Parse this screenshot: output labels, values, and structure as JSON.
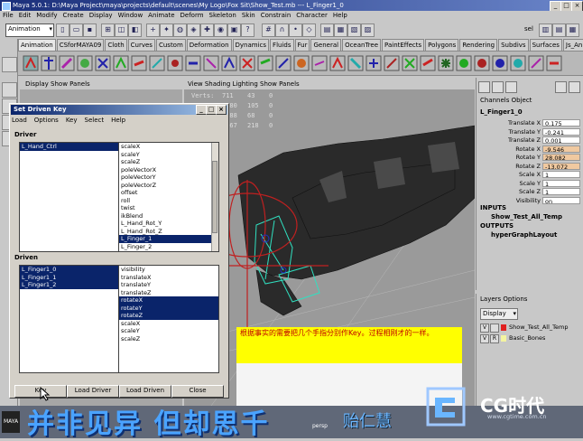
{
  "window": {
    "title": "Maya 5.0.1: D:\\Maya Project\\maya\\projects\\default\\scenes\\My Logo\\Fox Sit\\Show_Test.mb  ---  L_Finger1_0"
  },
  "menubar": [
    "File",
    "Edit",
    "Modify",
    "Create",
    "Display",
    "Window",
    "Animate",
    "Deform",
    "Skeleton",
    "Skin",
    "Constrain",
    "Character",
    "Help"
  ],
  "statusline": {
    "mode": "Animation",
    "sel_label": "sel"
  },
  "shelf_tabs": [
    "Animation",
    "CSforMAYA09",
    "Cloth",
    "Curves",
    "Custom",
    "Deformation",
    "Dynamics",
    "Fluids",
    "Fur",
    "General",
    "OceanTree",
    "PaintEffects",
    "Polygons",
    "Rendering",
    "Subdivs",
    "Surfaces",
    "Js_Animation"
  ],
  "panels": {
    "left_menu": "Display  Show  Panels",
    "view_menu": "View  Shading  Lighting  Show  Panels",
    "hud": [
      {
        "label": "Verts:",
        "a": "711",
        "b": "43",
        "c": "0"
      },
      {
        "label": "",
        "a": "1380",
        "b": "105",
        "c": "0"
      },
      {
        "label": "",
        "a": "1388",
        "b": "68",
        "c": "0"
      },
      {
        "label": "",
        "a": "1067",
        "b": "218",
        "c": "0"
      }
    ],
    "camera": "persp"
  },
  "channel_box": {
    "menu": "Channels  Object",
    "object": "L_Finger1_0",
    "attributes": [
      {
        "name": "Translate X",
        "value": "0.175",
        "keyed": false
      },
      {
        "name": "Translate Y",
        "value": "-0.241",
        "keyed": false
      },
      {
        "name": "Translate Z",
        "value": "0.001",
        "keyed": false
      },
      {
        "name": "Rotate X",
        "value": "-9.546",
        "keyed": true
      },
      {
        "name": "Rotate Y",
        "value": "28.082",
        "keyed": true
      },
      {
        "name": "Rotate Z",
        "value": "-13.072",
        "keyed": true
      },
      {
        "name": "Scale X",
        "value": "1",
        "keyed": false
      },
      {
        "name": "Scale Y",
        "value": "1",
        "keyed": false
      },
      {
        "name": "Scale Z",
        "value": "1",
        "keyed": false
      },
      {
        "name": "Visibility",
        "value": "on",
        "keyed": false
      }
    ],
    "inputs_label": "INPUTS",
    "inputs_item": "Show_Test_All_Temp",
    "outputs_label": "OUTPUTS",
    "outputs_item": "hyperGraphLayout"
  },
  "layers": {
    "menu": "Layers  Options",
    "dropdown": "Display",
    "rows": [
      {
        "v": "V",
        "r": "",
        "color": "#e02020",
        "name": "Show_Test_All_Temp"
      },
      {
        "v": "V",
        "r": "R",
        "color": "#f4f4a0",
        "name": "Basic_Bones"
      }
    ]
  },
  "sdk": {
    "title": "Set Driven Key",
    "menu": [
      "Load",
      "Options",
      "Key",
      "Select",
      "Help"
    ],
    "driver_label": "Driver",
    "driver_objects": [
      {
        "name": "L_Hand_Ctrl",
        "selected": true
      }
    ],
    "driver_attrs": [
      {
        "name": "scaleX",
        "selected": false
      },
      {
        "name": "scaleY",
        "selected": false
      },
      {
        "name": "scaleZ",
        "selected": false
      },
      {
        "name": "poleVectorX",
        "selected": false
      },
      {
        "name": "poleVectorY",
        "selected": false
      },
      {
        "name": "poleVectorZ",
        "selected": false
      },
      {
        "name": "offset",
        "selected": false
      },
      {
        "name": "roll",
        "selected": false
      },
      {
        "name": "twist",
        "selected": false
      },
      {
        "name": "ikBlend",
        "selected": false
      },
      {
        "name": "L_Hand_Rot_Y",
        "selected": false
      },
      {
        "name": "L_Hand_Rot_Z",
        "selected": false
      },
      {
        "name": "L_Finger_1",
        "selected": true
      },
      {
        "name": "L_Finger_2",
        "selected": false
      }
    ],
    "driven_label": "Driven",
    "driven_objects": [
      {
        "name": "L_Finger1_0",
        "selected": true
      },
      {
        "name": "L_Finger1_1",
        "selected": true
      },
      {
        "name": "L_Finger1_2",
        "selected": true
      }
    ],
    "driven_attrs": [
      {
        "name": "visibility",
        "selected": false
      },
      {
        "name": "translateX",
        "selected": false
      },
      {
        "name": "translateY",
        "selected": false
      },
      {
        "name": "translateZ",
        "selected": false
      },
      {
        "name": "rotateX",
        "selected": true
      },
      {
        "name": "rotateY",
        "selected": true
      },
      {
        "name": "rotateZ",
        "selected": true
      },
      {
        "name": "scaleX",
        "selected": false
      },
      {
        "name": "scaleY",
        "selected": false
      },
      {
        "name": "scaleZ",
        "selected": false
      }
    ],
    "buttons": {
      "key": "Key",
      "load_driver": "Load Driver",
      "load_driven": "Load Driven",
      "close": "Close"
    }
  },
  "note": "根据事实的需要把几个手指分别作Key。过程相刚才的一样。",
  "overlay": {
    "slogan": "并非见异 但却思千",
    "author": "贻仁慧",
    "brand": "CG时代",
    "url": "www.cgtime.com.cn"
  },
  "colors": {
    "selection": "#0a246a",
    "keyed_channel": "#f0c9a0",
    "note_bg": "#ffff00",
    "note_text": "#c00000"
  }
}
